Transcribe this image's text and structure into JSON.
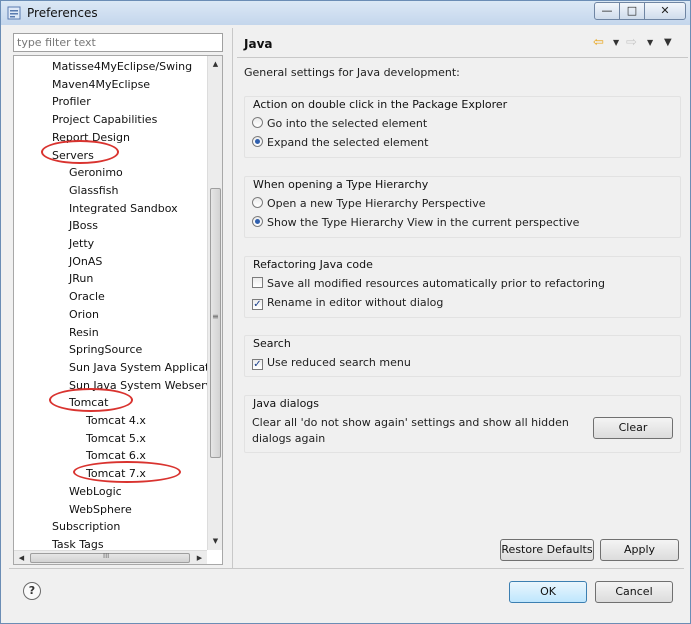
{
  "window": {
    "title": "Preferences",
    "controls": {
      "minimize": "—",
      "maximize": "□",
      "close": "✕"
    }
  },
  "sidebar": {
    "filter_placeholder": "type filter text",
    "items": [
      {
        "label": "Matisse4MyEclipse/Swing",
        "level": 1
      },
      {
        "label": "Maven4MyEclipse",
        "level": 1
      },
      {
        "label": "Profiler",
        "level": 1
      },
      {
        "label": "Project Capabilities",
        "level": 1
      },
      {
        "label": "Report Design",
        "level": 1
      },
      {
        "label": "Servers",
        "level": 1
      },
      {
        "label": "Geronimo",
        "level": 2
      },
      {
        "label": "Glassfish",
        "level": 2
      },
      {
        "label": "Integrated Sandbox",
        "level": 2
      },
      {
        "label": "JBoss",
        "level": 2
      },
      {
        "label": "Jetty",
        "level": 2
      },
      {
        "label": "JOnAS",
        "level": 2
      },
      {
        "label": "JRun",
        "level": 2
      },
      {
        "label": "Oracle",
        "level": 2
      },
      {
        "label": "Orion",
        "level": 2
      },
      {
        "label": "Resin",
        "level": 2
      },
      {
        "label": "SpringSource",
        "level": 2
      },
      {
        "label": "Sun Java System Applicatio",
        "level": 2
      },
      {
        "label": "Sun Java System Webserve",
        "level": 2
      },
      {
        "label": "Tomcat",
        "level": 2
      },
      {
        "label": "Tomcat  4.x",
        "level": 3
      },
      {
        "label": "Tomcat  5.x",
        "level": 3
      },
      {
        "label": "Tomcat  6.x",
        "level": 3
      },
      {
        "label": "Tomcat  7.x",
        "level": 3
      },
      {
        "label": "WebLogic",
        "level": 2
      },
      {
        "label": "WebSphere",
        "level": 2
      },
      {
        "label": "Subscription",
        "level": 1
      },
      {
        "label": "Task Tags",
        "level": 1
      }
    ],
    "scroll_thumb_grip": "≡",
    "hscroll_thumb_grip": "III"
  },
  "page": {
    "title": "Java",
    "description": "General settings for Java development:",
    "groups": {
      "double_click": {
        "label": "Action on double click in the Package Explorer",
        "options": [
          "Go into the selected element",
          "Expand the selected element"
        ],
        "selected": 1
      },
      "type_hierarchy": {
        "label": "When opening a Type Hierarchy",
        "options": [
          "Open a new Type Hierarchy Perspective",
          "Show the Type Hierarchy View in the current perspective"
        ],
        "selected": 1
      },
      "refactoring": {
        "label": "Refactoring Java code",
        "options": [
          {
            "label": "Save all modified resources automatically prior to refactoring",
            "checked": false
          },
          {
            "label": "Rename in editor without dialog",
            "checked": true
          }
        ]
      },
      "search": {
        "label": "Search",
        "options": [
          {
            "label": "Use reduced search menu",
            "checked": true
          }
        ]
      },
      "dialogs": {
        "label": "Java dialogs",
        "text_line1": "Clear all 'do not show again' settings and show all hidden",
        "text_line2": "dialogs again",
        "clear_label": "Clear"
      }
    }
  },
  "buttons": {
    "restore_defaults": "Restore Defaults",
    "apply": "Apply",
    "ok": "OK",
    "cancel": "Cancel",
    "help": "?"
  },
  "colors": {
    "accent": "#2f5fae",
    "annotation": "#d9332f",
    "nav_back": "#e8a317",
    "nav_forward": "#c8c8c8"
  }
}
